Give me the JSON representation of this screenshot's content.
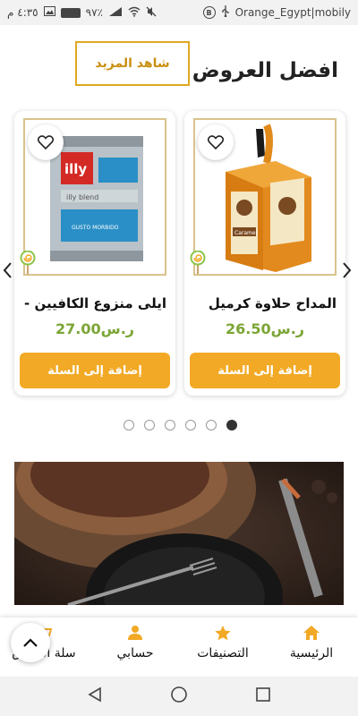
{
  "status_bar": {
    "time": "٤:٣٥ م",
    "battery": "٩٧٪",
    "carrier": "Orange_Egypt|mobily"
  },
  "offers": {
    "title": "افضل العروض",
    "see_more": "شاهد المزيد"
  },
  "products": [
    {
      "name": "المداح حلاوة كرميل",
      "price": "26.50",
      "currency": "ر.س",
      "add_to_cart": "إضافة إلى السلة",
      "image": "caramel-halawa-box"
    },
    {
      "name": "ايلى منزوع الكافيين - بن",
      "price": "27.00",
      "currency": "ر.س",
      "add_to_cart": "إضافة إلى السلة",
      "image": "illy-decaf-coffee-tin"
    }
  ],
  "carousel": {
    "dot_count": 6,
    "active_dot": 6
  },
  "bottom_nav": {
    "home": "الرئيسية",
    "categories": "التصنيفات",
    "account": "حسابي",
    "cart": "سلة التسوق"
  },
  "colors": {
    "accent": "#f2a925",
    "accent_border": "#e0a822",
    "price_green": "#7ba534"
  }
}
